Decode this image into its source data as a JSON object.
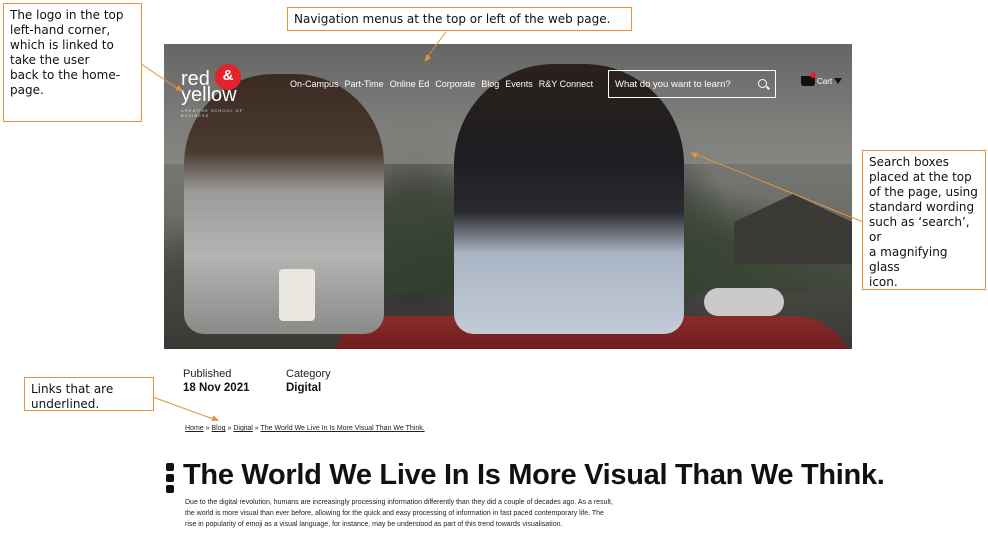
{
  "annotations": {
    "logo": "The logo in the top left-hand corner, which is linked to take the user back to the home-page.",
    "logo_lines": [
      "The logo in the top",
      "left-hand corner,",
      "which is linked to",
      "take the user",
      "back to the home-",
      "page."
    ],
    "navigation": "Navigation menus at the top or left of the web page.",
    "search": "Search boxes placed at the top of the page, using standard wording such as ‘search’, or a magnifying glass icon.",
    "search_lines": [
      "Search boxes",
      "placed at the top",
      "of the page, using",
      "standard wording",
      "such as ‘search’, or",
      "a magnifying glass",
      "icon."
    ],
    "links_lines": [
      "Links that are",
      "underlined."
    ]
  },
  "site": {
    "logo": {
      "line1": "red",
      "amp": "&",
      "line2": "yellow",
      "tagline": "CREATIVE SCHOOL OF BUSINESS"
    },
    "nav": [
      "On-Campus",
      "Part-Time",
      "Online Ed",
      "Corporate",
      "Blog",
      "Events",
      "R&Y Connect"
    ],
    "search_placeholder": "What do you want to learn?",
    "cart_label": "Cart",
    "search_icon": "magnifying-glass-icon",
    "cart_icon": "basket-icon"
  },
  "article": {
    "published_label": "Published",
    "published_value": "18 Nov 2021",
    "category_label": "Category",
    "category_value": "Digital",
    "breadcrumb": [
      "Home",
      "Blog",
      "Digital",
      "The World We Live In Is More Visual Than We Think."
    ],
    "breadcrumb_sep": "»",
    "title": "The World We Live In Is More Visual Than We Think.",
    "body_lines": [
      "Due to the digital revolution, humans are increasingly processing information differently than they did a couple of decades ago. As a result,",
      "the world is more visual than ever before, allowing for the quick and easy processing of information in fast paced contemporary life. The",
      "rise in popularity of emoji as a visual language, for instance, may be understood as part of this trend towards visualisation."
    ]
  },
  "colors": {
    "accent": "#e8913a",
    "brand_red": "#e3222b"
  }
}
